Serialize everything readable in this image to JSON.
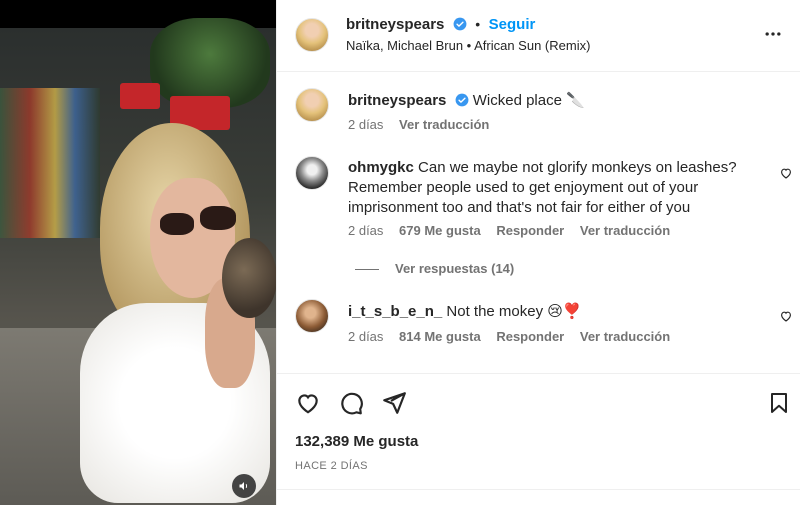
{
  "post_owner": {
    "username": "britneyspears",
    "follow_label": "Seguir",
    "audio": "Naïka, Michael Brun • African Sun (Remix)"
  },
  "caption": {
    "username": "britneyspears",
    "text": "Wicked place 🔪",
    "age": "2 días",
    "translate": "Ver traducción"
  },
  "comments": [
    {
      "username": "ohmygkc",
      "text": "Can we maybe not glorify monkeys on leashes? Remember people used to get enjoyment out of your imprisonment too and that's not fair for either of you",
      "age": "2 días",
      "likes": "679 Me gusta",
      "reply": "Responder",
      "translate": "Ver traducción",
      "view_replies": "Ver respuestas (14)"
    },
    {
      "username": "i_t_s_b_e_n_",
      "text": "Not the mokey 😢❣️",
      "age": "2 días",
      "likes": "814 Me gusta",
      "reply": "Responder",
      "translate": "Ver traducción"
    }
  ],
  "footer": {
    "likes": "132,389 Me gusta",
    "date": "HACE 2 DÍAS"
  },
  "colors": {
    "accent": "#0095f6",
    "verified": "#3897f0",
    "text": "#262626",
    "muted": "#737373"
  },
  "icons": [
    "verified-icon",
    "more-options-icon",
    "heart-icon",
    "comment-icon",
    "share-icon",
    "bookmark-icon",
    "audio-icon"
  ]
}
